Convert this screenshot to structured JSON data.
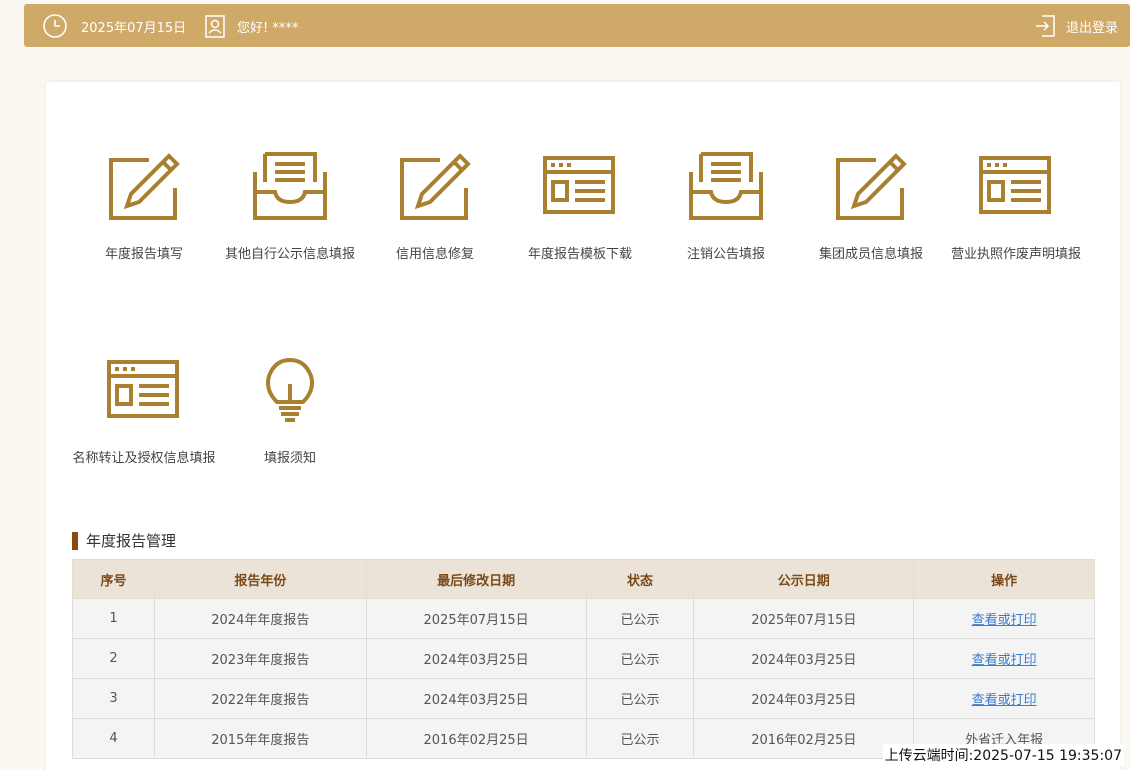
{
  "header": {
    "date": "2025年07月15日",
    "greeting": "您好! ****",
    "logout_label": "退出登录",
    "bar_color": "#cfa968"
  },
  "tiles": [
    {
      "label": "年度报告填写",
      "icon": "edit-icon"
    },
    {
      "label": "其他自行公示信息填报",
      "icon": "inbox-icon"
    },
    {
      "label": "信用信息修复",
      "icon": "edit-icon"
    },
    {
      "label": "年度报告模板下载",
      "icon": "template-icon"
    },
    {
      "label": "注销公告填报",
      "icon": "inbox-icon"
    },
    {
      "label": "集团成员信息填报",
      "icon": "edit-icon"
    },
    {
      "label": "营业执照作废声明填报",
      "icon": "template-icon"
    },
    {
      "label": "名称转让及授权信息填报",
      "icon": "template-icon"
    },
    {
      "label": "填报须知",
      "icon": "lightbulb-icon"
    }
  ],
  "section": {
    "title": "年度报告管理"
  },
  "table": {
    "headers": [
      "序号",
      "报告年份",
      "最后修改日期",
      "状态",
      "公示日期",
      "操作"
    ],
    "rows": [
      {
        "no": "1",
        "year": "2024年年度报告",
        "modified": "2025年07月15日",
        "status": "已公示",
        "published": "2025年07月15日",
        "action": "查看或打印",
        "action_link": true
      },
      {
        "no": "2",
        "year": "2023年年度报告",
        "modified": "2024年03月25日",
        "status": "已公示",
        "published": "2024年03月25日",
        "action": "查看或打印",
        "action_link": true
      },
      {
        "no": "3",
        "year": "2022年年度报告",
        "modified": "2024年03月25日",
        "status": "已公示",
        "published": "2024年03月25日",
        "action": "查看或打印",
        "action_link": true
      },
      {
        "no": "4",
        "year": "2015年年度报告",
        "modified": "2016年02月25日",
        "status": "已公示",
        "published": "2016年02月25日",
        "action": "外省迁入年报",
        "action_link": false
      }
    ]
  },
  "footer": {
    "upload_time": "上传云端时间:2025-07-15 19:35:07"
  },
  "colors": {
    "accent": "#a8802f",
    "link": "#3d7cc9",
    "section_bar": "#8a4a12"
  }
}
